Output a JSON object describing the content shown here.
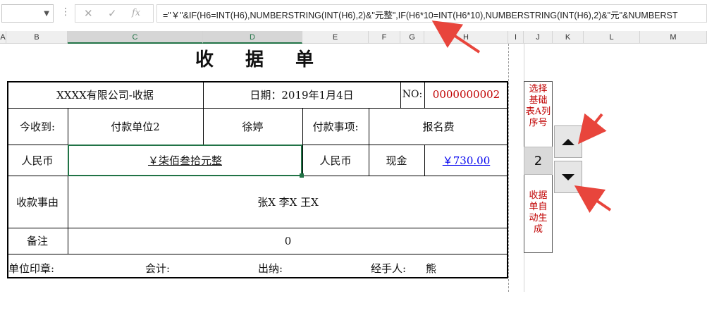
{
  "formula_bar": {
    "formula": "=\"￥\"&IF(H6=INT(H6),NUMBERSTRING(INT(H6),2)&\"元整\",IF(H6*10=INT(H6*10),NUMBERSTRING(INT(H6),2)&\"元\"&NUMBERST"
  },
  "columns": [
    "A",
    "B",
    "C",
    "D",
    "E",
    "F",
    "G",
    "H",
    "I",
    "J",
    "K",
    "L",
    "M"
  ],
  "receipt": {
    "title": "收 据 单",
    "company": "XXXX有限公司-收据",
    "date": "日期：2019年1月4日",
    "no_label": "NO:",
    "no_value": "0000000002",
    "received_from_label": "今收到:",
    "payer": "付款单位2",
    "payer_person": "徐婷",
    "item_label": "付款事项:",
    "item_value": "报名费",
    "rmb_label": "人民币",
    "amount_words": "￥柒佰叁拾元整",
    "rmb_label2": "人民币",
    "pay_method": "现金",
    "amount": "￥730.00",
    "reason_label": "收款事由",
    "reason_value": "张X 李X 王X",
    "note_label": "备注",
    "note_value": "0",
    "seal_label": "单位印章:",
    "accountant_label": "会计:",
    "cashier_label": "出纳:",
    "handler_label": "经手人:",
    "handler_value": "熊"
  },
  "side": {
    "select_hint": "选择基础表A列序号",
    "auto_hint": "收据单自动生成",
    "spin_value": "2"
  },
  "colors": {
    "accent": "#217346",
    "red": "#c00000",
    "link": "#0000ee"
  }
}
